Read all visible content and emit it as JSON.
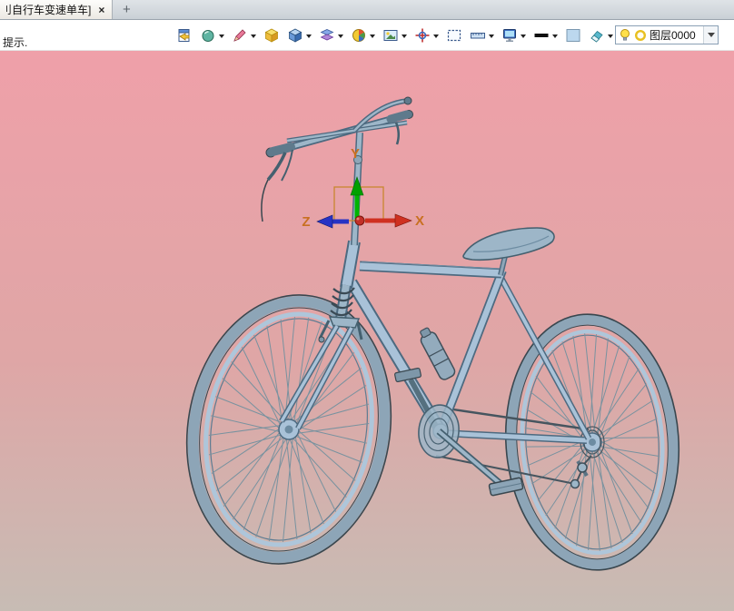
{
  "tabbar": {
    "title": "刂自行车变速单车]",
    "close_label": "×",
    "new_tab_label": "+"
  },
  "toolbar": {
    "hint": "提示.",
    "icons": [
      {
        "name": "export-sheet",
        "dropdown": false
      },
      {
        "name": "render-shaded",
        "dropdown": true
      },
      {
        "name": "brush-style",
        "dropdown": true
      },
      {
        "name": "iso-cube-yellow",
        "dropdown": false
      },
      {
        "name": "cube-blue",
        "dropdown": true
      },
      {
        "name": "layers",
        "dropdown": true
      },
      {
        "name": "color-wheel",
        "dropdown": true
      },
      {
        "name": "image-capture",
        "dropdown": true
      },
      {
        "name": "move-target",
        "dropdown": true
      },
      {
        "name": "select-frame",
        "dropdown": false
      },
      {
        "name": "ruler-measure",
        "dropdown": true
      },
      {
        "name": "monitor-display",
        "dropdown": true
      },
      {
        "name": "line-width",
        "dropdown": true
      },
      {
        "name": "color-swatch",
        "dropdown": false
      },
      {
        "name": "eraser",
        "dropdown": true
      }
    ],
    "layer_combo": {
      "value": "图层0000"
    }
  },
  "viewport": {
    "axes": {
      "x_label": "X",
      "y_label": "Y",
      "z_label": "Z"
    },
    "colors": {
      "x_axis": "#cf3020",
      "y_axis": "#00b400",
      "z_axis": "#2733c4",
      "axis_label": "#c87020",
      "selection_box": "#c8872f",
      "bg_top": "#efa0a9",
      "bg_bottom": "#c7bcb4",
      "bike_body": "#a9c2d8",
      "bike_outline": "#4d6a80",
      "tire": "#8da5b7"
    }
  }
}
